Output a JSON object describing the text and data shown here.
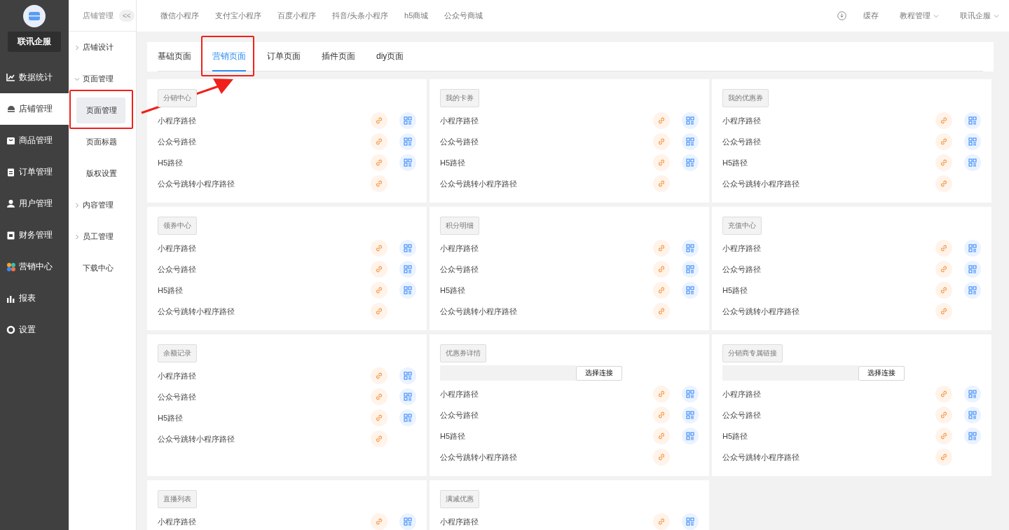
{
  "brand": {
    "name": "联讯企服"
  },
  "main_menu": [
    {
      "label": "数据统计",
      "selected": false
    },
    {
      "label": "店铺管理",
      "selected": true
    },
    {
      "label": "商品管理",
      "selected": false
    },
    {
      "label": "订单管理",
      "selected": false
    },
    {
      "label": "用户管理",
      "selected": false
    },
    {
      "label": "财务管理",
      "selected": false
    },
    {
      "label": "营销中心",
      "selected": false
    },
    {
      "label": "报表",
      "selected": false
    },
    {
      "label": "设置",
      "selected": false
    }
  ],
  "submenu": {
    "title": "店铺管理",
    "collapse": "<<",
    "items": [
      {
        "label": "店铺设计",
        "expanded": false
      },
      {
        "label": "页面管理",
        "expanded": true,
        "children": [
          {
            "label": "页面管理",
            "selected": true
          },
          {
            "label": "页面标题",
            "selected": false
          },
          {
            "label": "版权设置",
            "selected": false
          }
        ]
      },
      {
        "label": "内容管理",
        "expanded": false
      },
      {
        "label": "员工管理",
        "expanded": false
      },
      {
        "label": "下载中心"
      }
    ]
  },
  "top_nav": {
    "links": [
      "微信小程序",
      "支付宝小程序",
      "百度小程序",
      "抖音/头条小程序",
      "h5商城",
      "公众号商城"
    ],
    "cache": "缓存",
    "tutorial": "教程管理",
    "account": "联讯企服"
  },
  "tabs": [
    {
      "label": "基础页面",
      "selected": false
    },
    {
      "label": "营销页面",
      "selected": true
    },
    {
      "label": "订单页面",
      "selected": false
    },
    {
      "label": "插件页面",
      "selected": false
    },
    {
      "label": "diy页面",
      "selected": false
    }
  ],
  "cards": [
    {
      "title": "分销中心",
      "paths": [
        {
          "label": "小程序路径",
          "qr": true
        },
        {
          "label": "公众号路径",
          "qr": true
        },
        {
          "label": "H5路径",
          "qr": true
        },
        {
          "label": "公众号跳转小程序路径",
          "qr": false
        }
      ]
    },
    {
      "title": "我的卡券",
      "paths": [
        {
          "label": "小程序路径",
          "qr": true
        },
        {
          "label": "公众号路径",
          "qr": true
        },
        {
          "label": "H5路径",
          "qr": true
        },
        {
          "label": "公众号跳转小程序路径",
          "qr": false
        }
      ]
    },
    {
      "title": "我的优惠券",
      "paths": [
        {
          "label": "小程序路径",
          "qr": true
        },
        {
          "label": "公众号路径",
          "qr": true
        },
        {
          "label": "H5路径",
          "qr": true
        },
        {
          "label": "公众号跳转小程序路径",
          "qr": false
        }
      ]
    },
    {
      "title": "领券中心",
      "paths": [
        {
          "label": "小程序路径",
          "qr": true
        },
        {
          "label": "公众号路径",
          "qr": true
        },
        {
          "label": "H5路径",
          "qr": true
        },
        {
          "label": "公众号跳转小程序路径",
          "qr": false
        }
      ]
    },
    {
      "title": "积分明细",
      "paths": [
        {
          "label": "小程序路径",
          "qr": true
        },
        {
          "label": "公众号路径",
          "qr": true
        },
        {
          "label": "H5路径",
          "qr": true
        },
        {
          "label": "公众号跳转小程序路径",
          "qr": false
        }
      ]
    },
    {
      "title": "充值中心",
      "paths": [
        {
          "label": "小程序路径",
          "qr": true
        },
        {
          "label": "公众号路径",
          "qr": true
        },
        {
          "label": "H5路径",
          "qr": true
        },
        {
          "label": "公众号跳转小程序路径",
          "qr": false
        }
      ]
    },
    {
      "title": "余额记录",
      "paths": [
        {
          "label": "小程序路径",
          "qr": true
        },
        {
          "label": "公众号路径",
          "qr": true
        },
        {
          "label": "H5路径",
          "qr": true
        },
        {
          "label": "公众号跳转小程序路径",
          "qr": false
        }
      ]
    },
    {
      "title": "优惠券详情",
      "picker": {
        "button": "选择连接"
      },
      "paths": [
        {
          "label": "小程序路径",
          "qr": true
        },
        {
          "label": "公众号路径",
          "qr": true
        },
        {
          "label": "H5路径",
          "qr": true
        },
        {
          "label": "公众号跳转小程序路径",
          "qr": false
        }
      ]
    },
    {
      "title": "分销商专属链接",
      "picker": {
        "button": "选择连接"
      },
      "paths": [
        {
          "label": "小程序路径",
          "qr": true
        },
        {
          "label": "公众号路径",
          "qr": true
        },
        {
          "label": "H5路径",
          "qr": true
        },
        {
          "label": "公众号跳转小程序路径",
          "qr": false
        }
      ]
    },
    {
      "title": "直播列表",
      "paths": [
        {
          "label": "小程序路径",
          "qr": true
        }
      ]
    },
    {
      "title": "满减优惠",
      "paths": [
        {
          "label": "小程序路径",
          "qr": true
        }
      ]
    }
  ]
}
